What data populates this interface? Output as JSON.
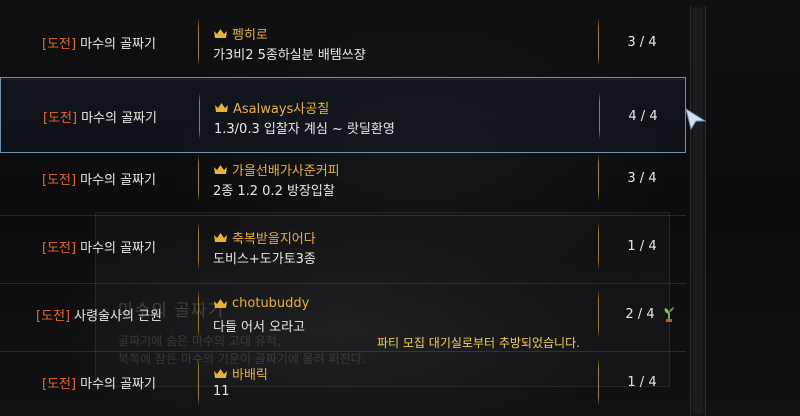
{
  "background": {
    "panel_title": "마수의 골짜기",
    "panel_line1": "골짜기에 숨은 마수의 고대 유적,",
    "panel_line2": "북쪽에 잠든 마수의 기운이 골짜기에 몰려 퍼진다."
  },
  "party_list": {
    "rows": [
      {
        "tag": "[도전]",
        "dungeon": "마수의 골짜기",
        "leader": "펭히로",
        "description": "가3비2 5종하실분 배템쓰쟝",
        "count": "3 / 4"
      },
      {
        "tag": "[도전]",
        "dungeon": "마수의 골짜기",
        "leader": "Asalways사공칠",
        "description": "1.3/0.3 입찰자 계심 ~ 랏딜환영",
        "count": "4 / 4"
      },
      {
        "tag": "[도전]",
        "dungeon": "마수의 골짜기",
        "leader": "가을선배가사준커피",
        "description": "2종 1.2 0.2 방장입찰",
        "count": "3 / 4"
      },
      {
        "tag": "[도전]",
        "dungeon": "마수의 골짜기",
        "leader": "축복받을지어다",
        "description": "도비스+도가토3종",
        "count": "1 / 4"
      },
      {
        "tag": "[도전]",
        "dungeon": "사령술사의 근원",
        "leader": "chotubuddy",
        "description": "다들 어서 오라고",
        "count": "2 / 4"
      },
      {
        "tag": "[도전]",
        "dungeon": "마수의 골짜기",
        "leader": "바배릭",
        "description": "11",
        "count": "1 / 4"
      }
    ],
    "selected_index": 1
  },
  "notice": "파티 모집 대기실로부터 추방되었습니다.",
  "colors": {
    "tag": "#e8642e",
    "leader": "#e7b23a",
    "notice": "#f0d34a",
    "selection_border": "#6f93b3"
  },
  "icons": {
    "leader": "crown-icon",
    "status": "plant-icon",
    "pointer": "cursor-icon"
  }
}
